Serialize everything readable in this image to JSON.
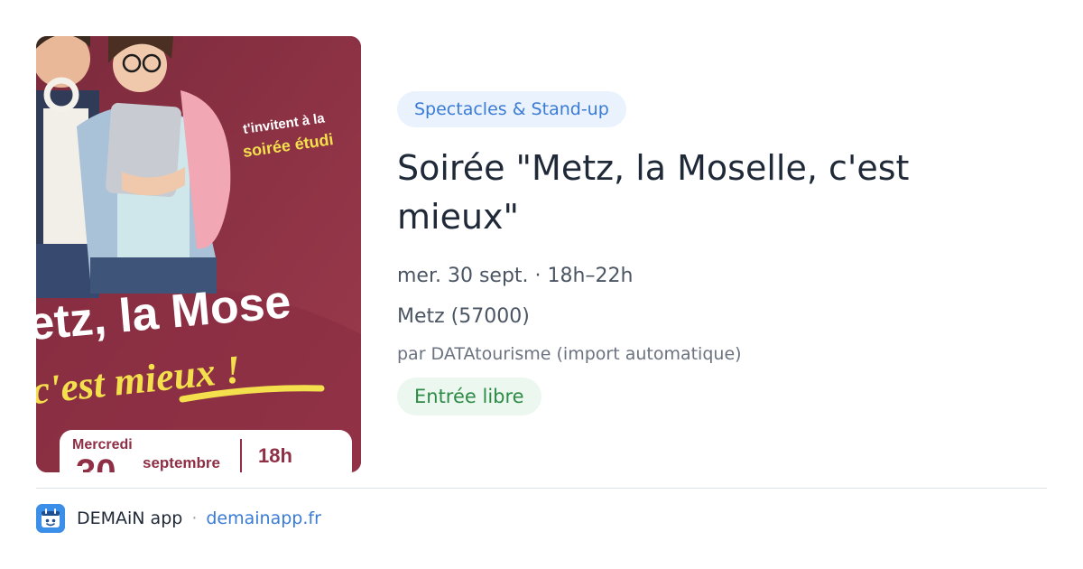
{
  "poster": {
    "tagline_line1": "t'invitent à la",
    "tagline_line2": "soirée étudi",
    "headline_line1": "etz, la Mose",
    "headline_line2": "c'est mieux !",
    "day_label": "Mercredi",
    "day_number": "30",
    "month_label": "septembre",
    "time_label": "18h",
    "colors": {
      "background": "#8e2f45",
      "accent": "#f4e04d"
    }
  },
  "event": {
    "category": "Spectacles & Stand-up",
    "title": "Soirée \"Metz, la Moselle, c'est mieux\"",
    "when": "mer. 30 sept. · 18h–22h",
    "where": "Metz (57000)",
    "organizer": "par DATAtourisme (import automatique)",
    "price": "Entrée libre"
  },
  "footer": {
    "app_icon": "demain-app-icon",
    "app_name": "DEMAiN app",
    "separator": "·",
    "domain": "demainapp.fr"
  }
}
